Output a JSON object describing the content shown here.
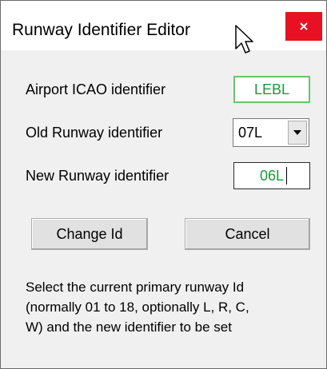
{
  "window": {
    "title": "Runway Identifier Editor",
    "close_glyph": "×",
    "close_icon": "close-icon",
    "cursor_icon": "arrow-cursor-icon"
  },
  "form": {
    "airport_label": "Airport ICAO identifier",
    "airport_value": "LEBL",
    "old_runway_label": "Old Runway identifier",
    "old_runway_value": "07L",
    "dropdown_icon": "chevron-down-icon",
    "new_runway_label": "New Runway identifier",
    "new_runway_value": "06L"
  },
  "buttons": {
    "change_label": "Change Id",
    "cancel_label": "Cancel"
  },
  "help": {
    "line1": "Select the current primary runway Id",
    "line2": "(normally 01 to 18, optionally L, R, C,",
    "line3": "W) and the new identifier to be set"
  },
  "colors": {
    "close_button": "#e81123",
    "value_text": "#1a9a3a",
    "dialog_background": "#f0f0f0"
  }
}
